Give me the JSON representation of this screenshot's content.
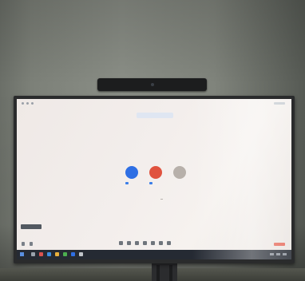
{
  "scene": {
    "description_hidden": false,
    "colors": {
      "wall": "#80847c",
      "tv_bezel": "#2a2b2c",
      "screen_bg": "#f3eeec",
      "accent_blue": "#2f6fe4",
      "accent_red": "#e0523e",
      "taskbar": "#252a33"
    }
  },
  "icons": {
    "camera": "webcam-bar-icon",
    "participants": [
      "avatar-blue",
      "avatar-red",
      "avatar-photo"
    ],
    "toolbar": [
      "mic-icon",
      "video-icon",
      "share-icon",
      "participants-icon",
      "chat-icon",
      "record-icon",
      "more-icon"
    ],
    "taskbar": [
      "windows-start-icon",
      "search-icon",
      "app-icons",
      "system-tray-icons"
    ]
  }
}
